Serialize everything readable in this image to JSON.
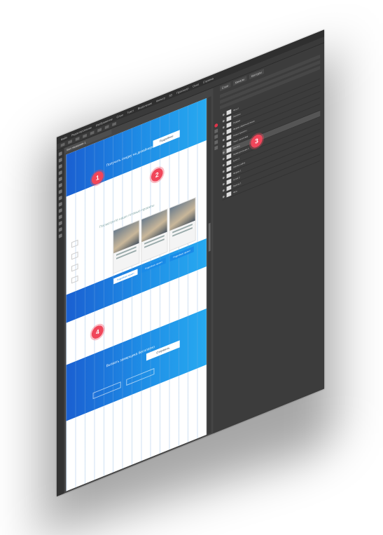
{
  "menu": [
    "Файл",
    "Редактирование",
    "Изображение",
    "Слои",
    "Текст",
    "Выделение",
    "Фильтр",
    "3D",
    "Просмотр",
    "Окно",
    "Справка"
  ],
  "doc_tab": "Без названия-1",
  "site": {
    "hero_text": "Получить скидку на дизайнерский ремонт",
    "hero_button": "Подробнее",
    "section_title": "Посмотрите наши готовые проекты",
    "card_button": "Подробнее проект",
    "card_button_alt": "Подробнее проект",
    "footer_text": "Вызвать замерщика бесплатно",
    "footer_button": "Отправить"
  },
  "badges": [
    "1",
    "2",
    "3",
    "4"
  ],
  "panel": {
    "tabs": [
      "Слои",
      "Каналы",
      "Контуры"
    ],
    "layers": [
      "Фон",
      "Группа 1",
      "Слой 2",
      "Форма 1",
      "Шапка сайта",
      "Блок 2",
      "Прямоугольник 1",
      "Кнопка",
      "Текст заголовка",
      "Наши проекты",
      "Форма обратной связи",
      "Подвал",
      "Логотип",
      "Фон 2"
    ]
  },
  "colors": {
    "accent": "#1a8be8",
    "badge": "#f0465a",
    "panel_bg": "#3c3c3c"
  }
}
